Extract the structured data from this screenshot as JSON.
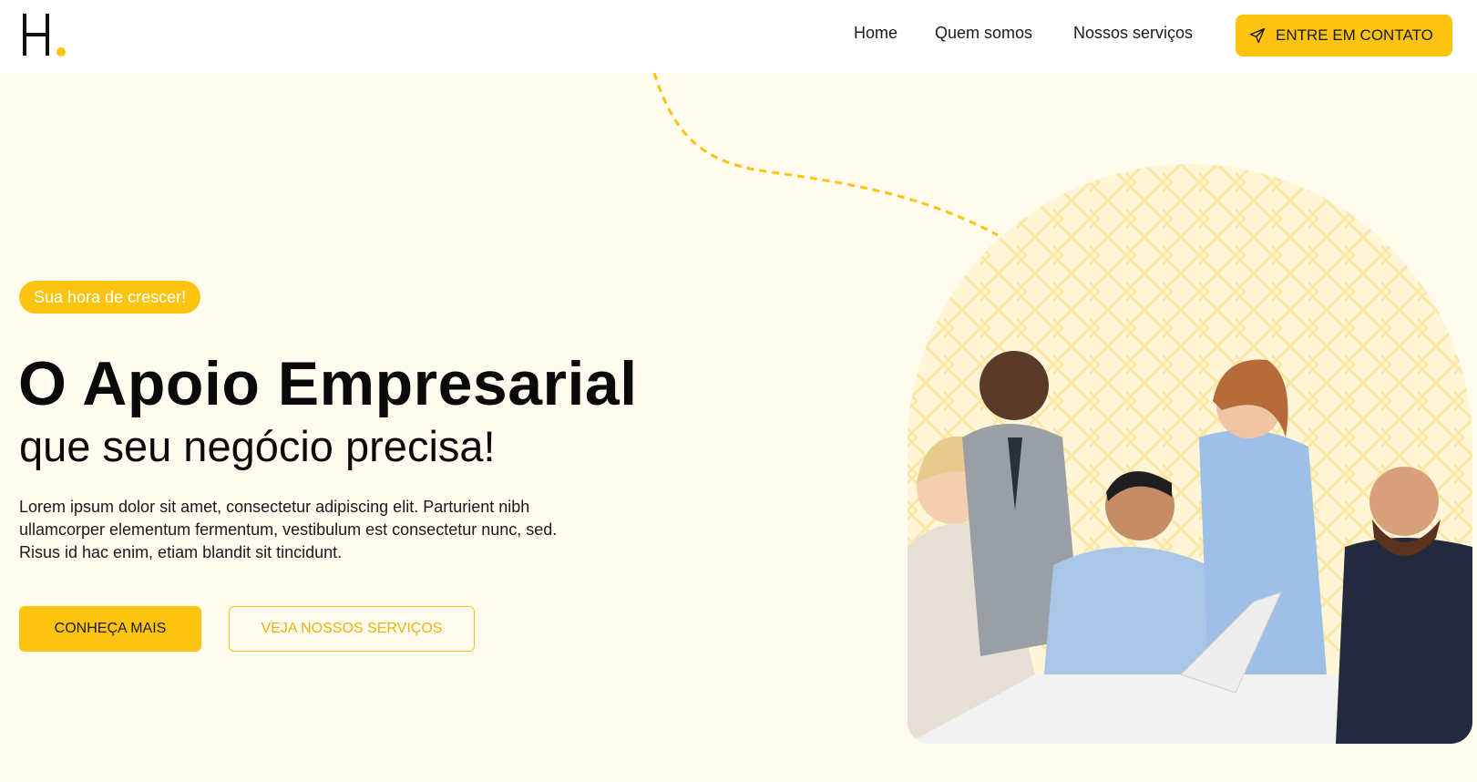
{
  "header": {
    "logo_letter": "H",
    "nav": {
      "home": "Home",
      "quem_somos": "Quem somos",
      "servicos": "Nossos serviços"
    },
    "cta_label": "ENTRE EM CONTATO",
    "cta_icon": "send-icon"
  },
  "hero": {
    "badge": "Sua hora de crescer!",
    "headline": "O Apoio Empresarial",
    "subheadline": "que seu negócio precisa!",
    "body": "Lorem ipsum dolor sit amet, consectetur adipiscing elit. Parturient nibh ullamcorper elementum fermentum, vestibulum est consectetur nunc, sed. Risus id hac enim, etiam blandit sit tincidunt.",
    "primary_button": "CONHEÇA MAIS",
    "secondary_button": "VEJA NOSSOS SERVIÇOS"
  },
  "colors": {
    "accent": "#fdc40f",
    "background": "#fffcef",
    "header_bg": "#ffffff",
    "text": "#0a0a0a"
  }
}
